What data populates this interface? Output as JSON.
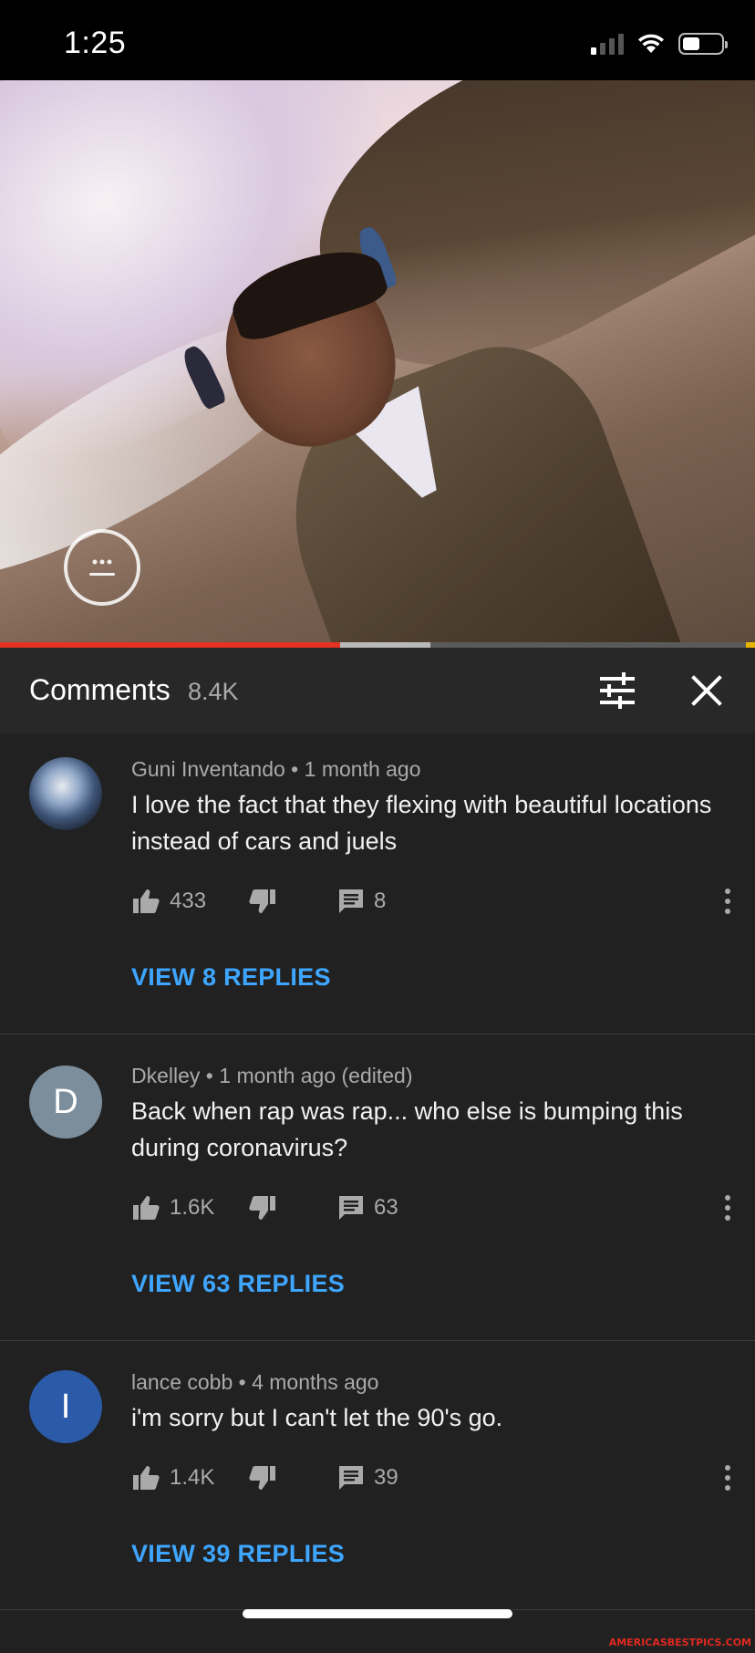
{
  "status_bar": {
    "time": "1:25"
  },
  "video": {
    "played_fraction": 0.45,
    "buffered_fraction": 0.57
  },
  "comments_panel": {
    "title": "Comments",
    "count": "8.4K",
    "icons": {
      "filter": "sort-filter-icon",
      "close": "close-icon"
    }
  },
  "comments": [
    {
      "author": "Guni Inventando",
      "time": "1 month ago",
      "text": "I love the fact that they flexing with beautiful locations instead of cars and juels",
      "likes": "433",
      "replies_count": "8",
      "view_replies": "VIEW 8 REPLIES",
      "avatar_letter": ""
    },
    {
      "author": "Dkelley",
      "time": "1 month ago (edited)",
      "text": "Back when rap was rap... who else is bumping this during coronavirus?",
      "likes": "1.6K",
      "replies_count": "63",
      "view_replies": "VIEW 63 REPLIES",
      "avatar_letter": "D",
      "avatar_color": "#7c8e9c"
    },
    {
      "author": "lance cobb",
      "time": "4 months ago",
      "text": "i'm sorry  but I can't let the 90's go.",
      "likes": "1.4K",
      "replies_count": "39",
      "view_replies": "VIEW 39 REPLIES",
      "avatar_letter": "I",
      "avatar_color": "#2a5aa8"
    }
  ],
  "watermark": "AMERICASBESTPICS.COM",
  "colors": {
    "accent_link": "#3ea6ff",
    "progress_played": "#e53224"
  }
}
